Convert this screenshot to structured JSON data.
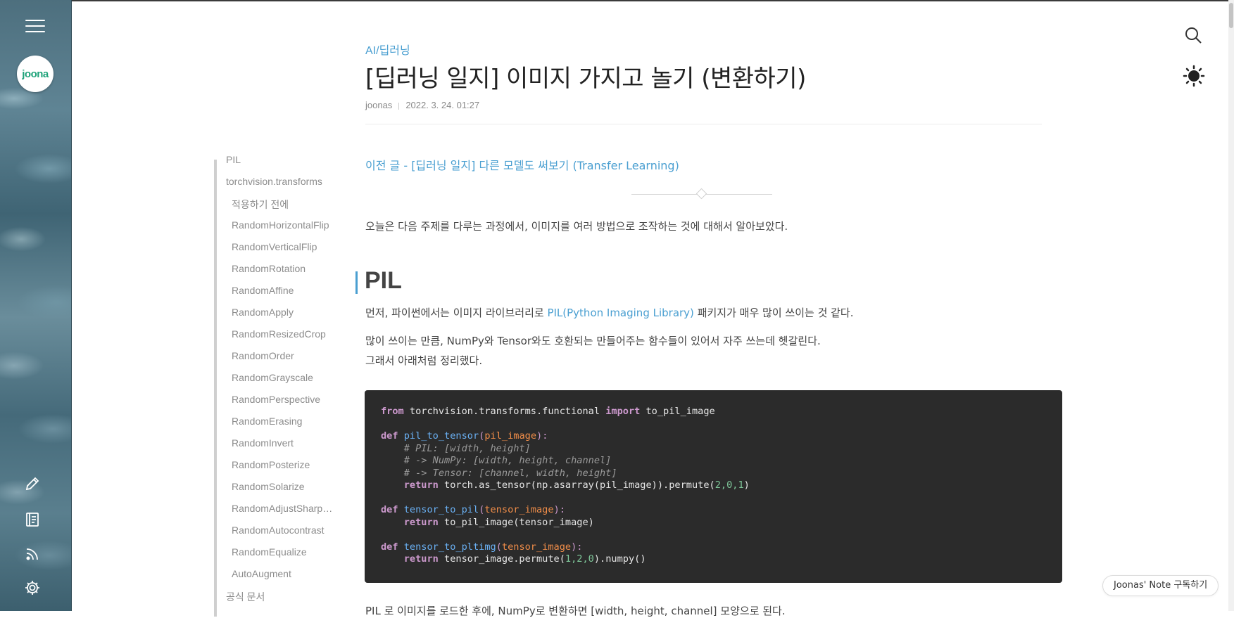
{
  "sidebar": {
    "logo_text": "joona"
  },
  "header": {
    "category": "AI/딥러닝",
    "title": "[딥러닝 일지] 이미지 가지고 놀기 (변환하기)",
    "author": "joonas",
    "date": "2022. 3. 24. 01:27"
  },
  "toc": {
    "items": [
      {
        "label": "PIL",
        "level": 1
      },
      {
        "label": "torchvision.transforms",
        "level": 1
      },
      {
        "label": "적용하기 전에",
        "level": 2
      },
      {
        "label": "RandomHorizontalFlip",
        "level": 2
      },
      {
        "label": "RandomVerticalFlip",
        "level": 2
      },
      {
        "label": "RandomRotation",
        "level": 2
      },
      {
        "label": "RandomAffine",
        "level": 2
      },
      {
        "label": "RandomApply",
        "level": 2
      },
      {
        "label": "RandomResizedCrop",
        "level": 2
      },
      {
        "label": "RandomOrder",
        "level": 2
      },
      {
        "label": "RandomGrayscale",
        "level": 2
      },
      {
        "label": "RandomPerspective",
        "level": 2
      },
      {
        "label": "RandomErasing",
        "level": 2
      },
      {
        "label": "RandomInvert",
        "level": 2
      },
      {
        "label": "RandomPosterize",
        "level": 2
      },
      {
        "label": "RandomSolarize",
        "level": 2
      },
      {
        "label": "RandomAdjustSharpness",
        "level": 2
      },
      {
        "label": "RandomAutocontrast",
        "level": 2
      },
      {
        "label": "RandomEqualize",
        "level": 2
      },
      {
        "label": "AutoAugment",
        "level": 2
      },
      {
        "label": "공식 문서",
        "level": 1
      }
    ]
  },
  "content": {
    "prev_link": "이전 글 - [딥러닝 일지] 다른 모델도 써보기 (Transfer Learning)",
    "intro": "오늘은 다음 주제를 다루는 과정에서, 이미지를 여러 방법으로 조작하는 것에 대해서 알아보았다.",
    "section_heading": "PIL",
    "p1_before": "먼저, 파이썬에서는 이미지 라이브러리로 ",
    "p1_link": "PIL(Python Imaging Library)",
    "p1_after": " 패키지가 매우 많이 쓰이는 것 같다.",
    "p2": "많이 쓰이는 만큼, NumPy와 Tensor와도 호환되는 만들어주는 함수들이 있어서 자주 쓰는데 헷갈린다.",
    "p3": "그래서 아래처럼 정리했다.",
    "code": {
      "l1_kw1": "from",
      "l1_mod": " torchvision.transforms.functional ",
      "l1_kw2": "import",
      "l1_name": " to_pil_image",
      "l2_kw": "def",
      "l2_fn": "pil_to_tensor",
      "l2_param": "pil_image",
      "l3": "    # PIL: [width, height]",
      "l4": "    # -> NumPy: [width, height, channel]",
      "l5": "    # -> Tensor: [channel, width, height]",
      "l6_kw": "return",
      "l6_body": " torch.as_tensor(np.asarray(pil_image)).permute(",
      "l6_args": "2,0,1",
      "l6_end": ")",
      "l7_kw": "def",
      "l7_fn": "tensor_to_pil",
      "l7_param": "tensor_image",
      "l8_kw": "return",
      "l8_body": " to_pil_image(tensor_image)",
      "l9_kw": "def",
      "l9_fn": "tensor_to_pltimg",
      "l9_param": "tensor_image",
      "l10_kw": "return",
      "l10_body": " tensor_image.permute(",
      "l10_args": "1,2,0",
      "l10_end": ").numpy()"
    },
    "cut_text": "PIL 로 이미지를 로드한 후에, NumPy로 변환하면 [width, height, channel] 모양으로 된다."
  },
  "subscribe_label": "Joonas' Note 구독하기"
}
